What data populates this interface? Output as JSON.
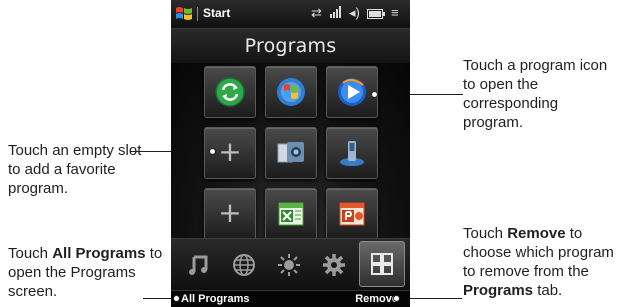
{
  "statusbar": {
    "start_label": "Start",
    "icons": [
      "connectivity-icon",
      "signal-icon",
      "volume-icon",
      "battery-icon",
      "menu-icon"
    ]
  },
  "title": "Programs",
  "tiles": [
    {
      "row": 1,
      "col": 1,
      "icon": "sync-icon"
    },
    {
      "row": 1,
      "col": 2,
      "icon": "internet-explorer-icon"
    },
    {
      "row": 1,
      "col": 3,
      "icon": "media-player-icon"
    },
    {
      "row": 2,
      "col": 1,
      "icon": "add-program-icon"
    },
    {
      "row": 2,
      "col": 2,
      "icon": "camera-album-icon"
    },
    {
      "row": 2,
      "col": 3,
      "icon": "comm-manager-icon"
    },
    {
      "row": 3,
      "col": 1,
      "icon": "add-program-icon"
    },
    {
      "row": 3,
      "col": 2,
      "icon": "excel-mobile-icon"
    },
    {
      "row": 3,
      "col": 3,
      "icon": "powerpoint-mobile-icon"
    }
  ],
  "tabs": [
    "music-tab-icon",
    "internet-tab-icon",
    "weather-tab-icon",
    "settings-tab-icon",
    "programs-tab-icon"
  ],
  "softkeys": {
    "left": "All Programs",
    "right": "Remove"
  },
  "callouts": {
    "program_icon": "Touch a program icon to open the corresponding program.",
    "empty_slot": "Touch an empty slot to add a favorite program.",
    "all_programs_pre": "Touch ",
    "all_programs_bold": "All Programs",
    "all_programs_post": " to open the Programs screen.",
    "remove_pre": "Touch ",
    "remove_bold": "Remove",
    "remove_mid": " to choose which program to remove from the ",
    "remove_bold2": "Programs",
    "remove_post": " tab."
  },
  "colors": {
    "accent_text": "#231f20",
    "phone_bg": "#0b0b0b"
  }
}
